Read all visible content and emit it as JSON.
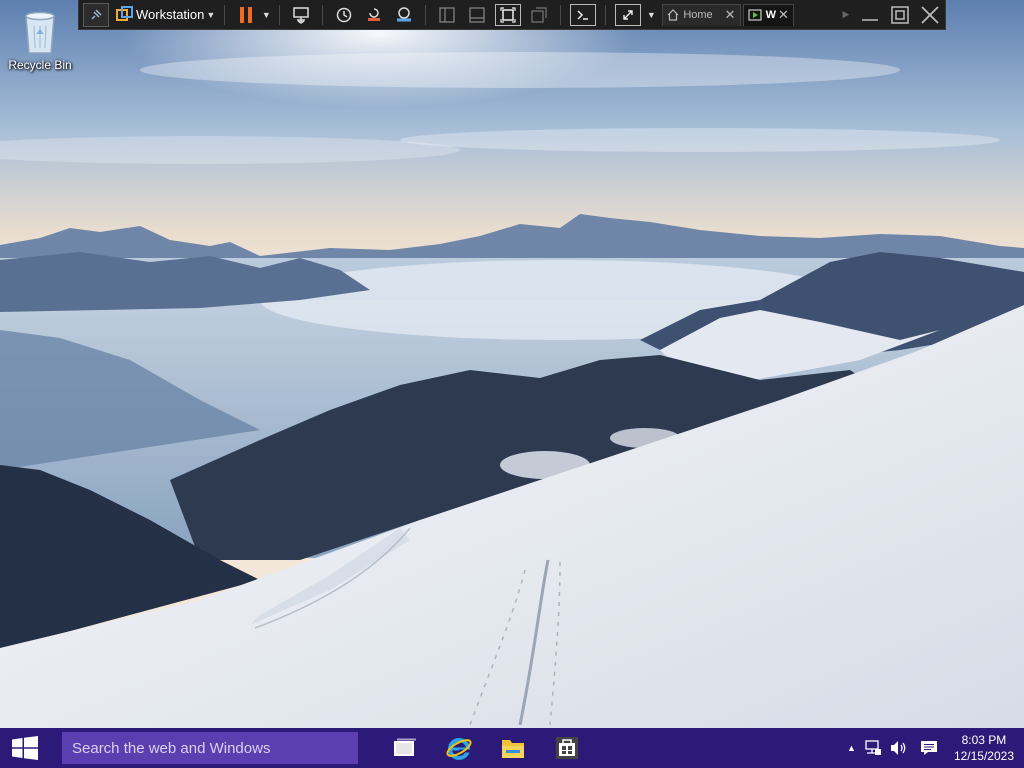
{
  "desktop": {
    "icons": [
      {
        "label": "Recycle Bin",
        "icon": "recycle-bin-icon"
      }
    ]
  },
  "vmware_toolbar": {
    "vm_name": "Workstation",
    "tabs": [
      {
        "label": "Home",
        "icon": "home-icon",
        "active": false
      },
      {
        "label": "W",
        "icon": "vm-running-icon",
        "active": true
      }
    ],
    "accent_color": "#f26b21",
    "icons": [
      "pin-icon",
      "vmware-logo-icon",
      "pause-icon",
      "send-ctrl-alt-del-icon",
      "snapshot-icon",
      "revert-snapshot-icon",
      "snapshot-manager-icon",
      "library-icon",
      "thumbnail-bar-icon",
      "fullscreen-icon",
      "unity-icon",
      "console-icon",
      "stretch-icon"
    ]
  },
  "taskbar": {
    "search_placeholder": "Search the web and Windows",
    "pinned_apps": [
      "task-view-icon",
      "internet-explorer-icon",
      "file-explorer-icon",
      "store-icon"
    ],
    "tray": {
      "time": "8:03 PM",
      "date": "12/15/2023",
      "icons": [
        "show-hidden-icons-icon",
        "network-icon",
        "volume-icon",
        "action-center-icon"
      ]
    },
    "background": "#2b1a78"
  }
}
